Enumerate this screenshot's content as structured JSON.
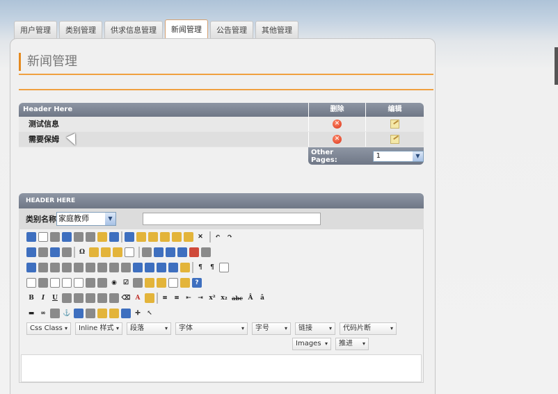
{
  "tabs": [
    {
      "label": "用户管理",
      "active": false
    },
    {
      "label": "类别管理",
      "active": false
    },
    {
      "label": "供求信息管理",
      "active": false
    },
    {
      "label": "新闻管理",
      "active": true
    },
    {
      "label": "公告管理",
      "active": false
    },
    {
      "label": "其他管理",
      "active": false
    }
  ],
  "page": {
    "title": "新闻管理"
  },
  "news_table": {
    "header": {
      "name": "Header Here",
      "delete": "删除",
      "edit": "编辑"
    },
    "rows": [
      {
        "name": "测试信息"
      },
      {
        "name": "需要保姆"
      }
    ],
    "pager": {
      "label": "Other Pages:",
      "value": "1"
    }
  },
  "form": {
    "header": "HEADER HERE",
    "category_label": "类别名称",
    "category_value": "家庭教师",
    "title_value": ""
  },
  "editor": {
    "toolbar_row6_text": [
      "B",
      "I",
      "U",
      "A",
      "x²",
      "x₂",
      "abc"
    ],
    "combos": {
      "css_class": "Css Class",
      "inline_style": "Inline 样式",
      "paragraph": "段落",
      "font": "字体",
      "font_size": "字号",
      "link": "链接",
      "code_snippet": "代码片断",
      "images": "Images",
      "advance": "推进"
    }
  },
  "colors": {
    "accent": "#e58a20",
    "header_bg": "#7b8391",
    "delete_icon": "#d9331a"
  }
}
